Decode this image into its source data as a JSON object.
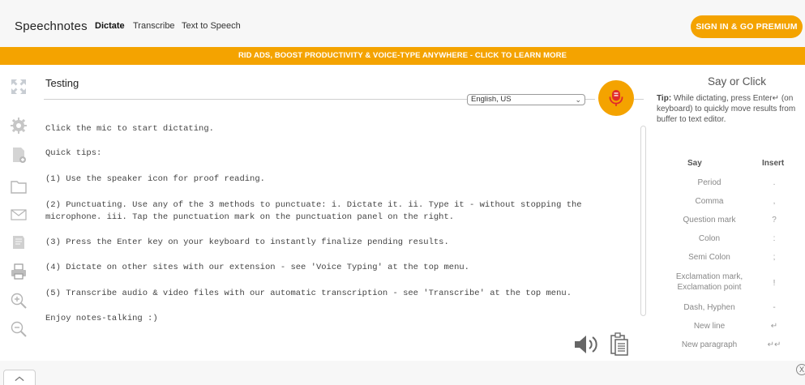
{
  "header": {
    "brand": "Speechnotes",
    "nav": {
      "dictate": "Dictate",
      "transcribe": "Transcribe",
      "tts": "Text to Speech"
    },
    "signin_label": "SIGN IN & GO PREMIUM"
  },
  "promo": {
    "text": "RID ADS, BOOST PRODUCTIVITY & VOICE-TYPE ANYWHERE - CLICK TO LEARN MORE"
  },
  "document": {
    "title": "Testing",
    "language": "English, US"
  },
  "editor": {
    "lines": [
      "Click the mic to start dictating.",
      "Quick tips:",
      "(1) Use the speaker icon for proof reading.",
      "(2) Punctuating. Use any of the 3 methods to punctuate: i. Dictate it. ii. Type it - without stopping the",
      "microphone. iii. Tap the punctuation mark on the punctuation panel on the right.",
      "(3) Press the Enter key on your keyboard to instantly finalize pending results.",
      "(4) Dictate on other sites with our extension - see 'Voice Typing' at the top menu.",
      "(5) Transcribe audio & video files with our automatic transcription - see 'Transcribe' at the top menu.",
      "Enjoy notes-talking :)"
    ]
  },
  "right_panel": {
    "title": "Say or Click",
    "tip_label": "Tip:",
    "tip_text": "While dictating, press Enter↵ (on keyboard) to quickly move results from buffer to text editor.",
    "col_say": "Say",
    "col_insert": "Insert",
    "rows": [
      {
        "say": "Period",
        "insert": "."
      },
      {
        "say": "Comma",
        "insert": ","
      },
      {
        "say": "Question mark",
        "insert": "?"
      },
      {
        "say": "Colon",
        "insert": ":"
      },
      {
        "say": "Semi Colon",
        "insert": ";"
      },
      {
        "say": "Exclamation mark, Exclamation point",
        "insert": "!"
      },
      {
        "say": "Dash, Hyphen",
        "insert": "-"
      },
      {
        "say": "New line",
        "insert": "↵"
      },
      {
        "say": "New paragraph",
        "insert": "↵↵"
      }
    ]
  },
  "bottom": {
    "close_glyph": "X"
  },
  "icons": {
    "left": [
      "fullscreen-icon",
      "settings-icon",
      "new-note-icon",
      "open-folder-icon",
      "email-icon",
      "print-stack-icon",
      "printer-icon",
      "zoom-in-icon",
      "zoom-out-icon"
    ],
    "speaker": "speaker-icon",
    "copy": "copy-icon",
    "mic": "mic-icon"
  },
  "colors": {
    "accent": "#f4a300",
    "topbar_bg": "#f7f7f7"
  }
}
